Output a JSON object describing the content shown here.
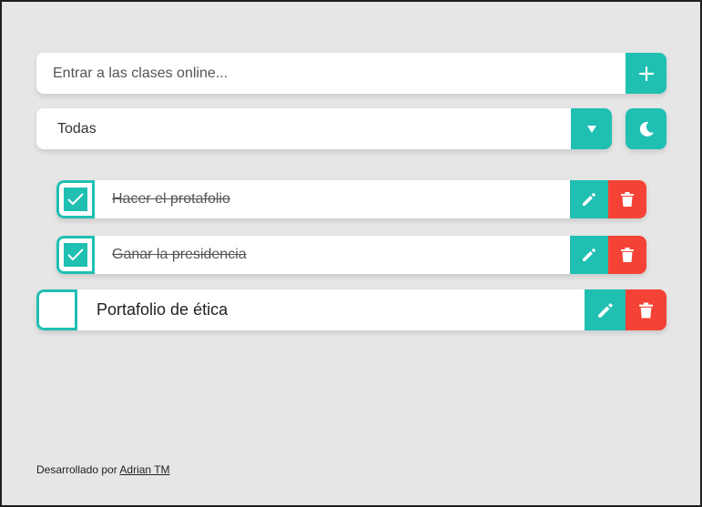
{
  "new_todo": {
    "placeholder": "Entrar a las clases online..."
  },
  "filter": {
    "selected": "Todas"
  },
  "todos": [
    {
      "text": "Hacer el protafolio",
      "completed": true
    },
    {
      "text": "Ganar la presidencia",
      "completed": true
    },
    {
      "text": "Portafolio de ética",
      "completed": false
    }
  ],
  "footer": {
    "prefix": "Desarrollado por",
    "author": "Adrian TM"
  },
  "colors": {
    "accent": "#1fbfb2",
    "danger": "#f44336",
    "background": "#e6e6e6"
  },
  "icons": {
    "add": "plus-icon",
    "dropdown": "caret-down-icon",
    "theme": "moon-icon",
    "check": "checkmark-icon",
    "edit": "pencil-icon",
    "delete": "trash-icon"
  }
}
